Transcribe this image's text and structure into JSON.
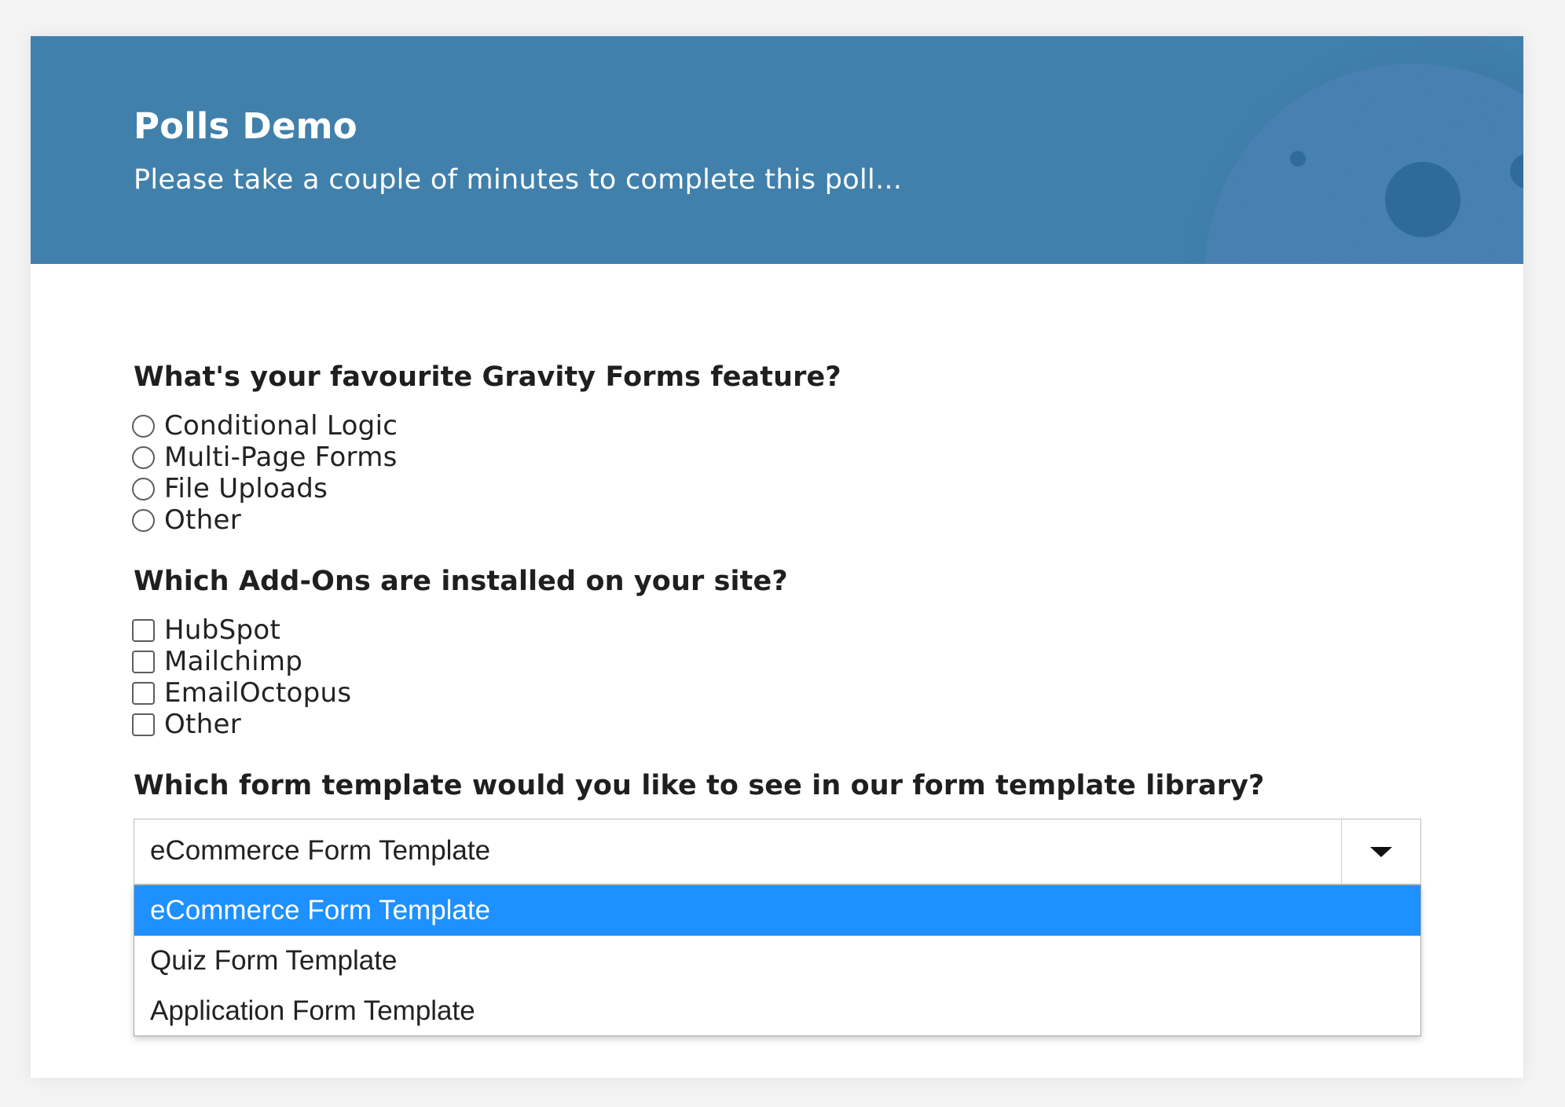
{
  "header": {
    "title": "Polls Demo",
    "subtitle": "Please take a couple of minutes to complete this poll..."
  },
  "colors": {
    "header_bg": "#4180ab",
    "selected_option_bg": "#1e90ff"
  },
  "questions": [
    {
      "label": "What's your favourite Gravity Forms feature?",
      "type": "radio",
      "options": [
        "Conditional Logic",
        "Multi-Page Forms",
        "File Uploads",
        "Other"
      ],
      "checked": [
        false,
        false,
        false,
        false
      ]
    },
    {
      "label": "Which Add-Ons are installed on your site?",
      "type": "checkbox",
      "options": [
        "HubSpot",
        "Mailchimp",
        "EmailOctopus",
        "Other"
      ],
      "checked": [
        false,
        false,
        false,
        false
      ]
    },
    {
      "label": "Which form template would you like to see in our form template library?",
      "type": "select",
      "selected_value": "eCommerce Form Template",
      "expanded": true,
      "options": [
        "eCommerce Form Template",
        "Quiz Form Template",
        "Application Form Template"
      ],
      "highlighted_option": "eCommerce Form Template"
    }
  ],
  "icons": {
    "dropdown_caret": "chevron-down-icon",
    "header_decoration": "planet-illustration"
  }
}
